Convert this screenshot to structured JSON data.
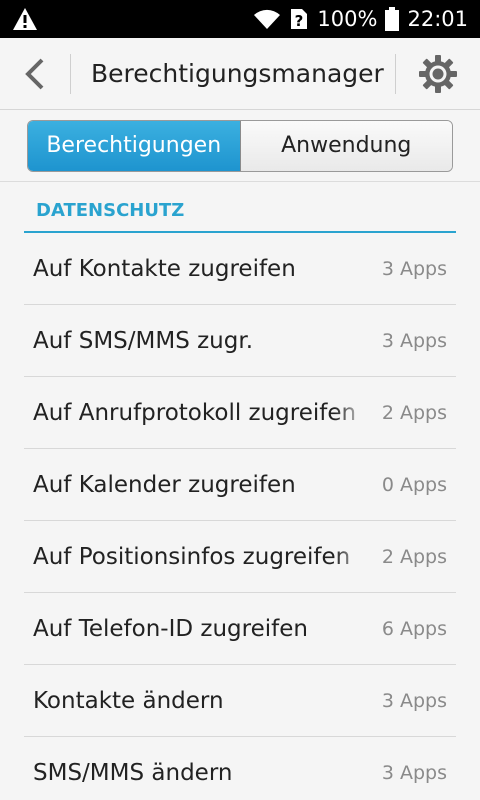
{
  "status_bar": {
    "battery": "100%",
    "time": "22:01",
    "icons": [
      "warning-icon",
      "wifi-icon",
      "sim-unknown-icon",
      "battery-icon"
    ]
  },
  "header": {
    "title": "Berechtigungsmanager",
    "back_icon": "back-arrow-icon",
    "settings_icon": "gear-icon"
  },
  "tabs": [
    {
      "label": "Berechtigungen",
      "active": true
    },
    {
      "label": "Anwendung",
      "active": false
    }
  ],
  "section": {
    "title": "DATENSCHUTZ"
  },
  "items": [
    {
      "label": "Auf Kontakte zugreifen",
      "count": "3 Apps"
    },
    {
      "label": "Auf SMS/MMS zugr.",
      "count": "3 Apps"
    },
    {
      "label": "Auf Anrufprotokoll zugreifen",
      "count": "2 Apps"
    },
    {
      "label": "Auf Kalender zugreifen",
      "count": "0 Apps"
    },
    {
      "label": "Auf Positionsinfos zugreifen",
      "count": "2 Apps"
    },
    {
      "label": "Auf Telefon-ID zugreifen",
      "count": "6 Apps"
    },
    {
      "label": "Kontakte ändern",
      "count": "3 Apps"
    },
    {
      "label": "SMS/MMS ändern",
      "count": "3 Apps"
    }
  ],
  "colors": {
    "accent": "#2aa3cf",
    "tab_active": "#1e94cf",
    "status_bar": "#000000"
  }
}
